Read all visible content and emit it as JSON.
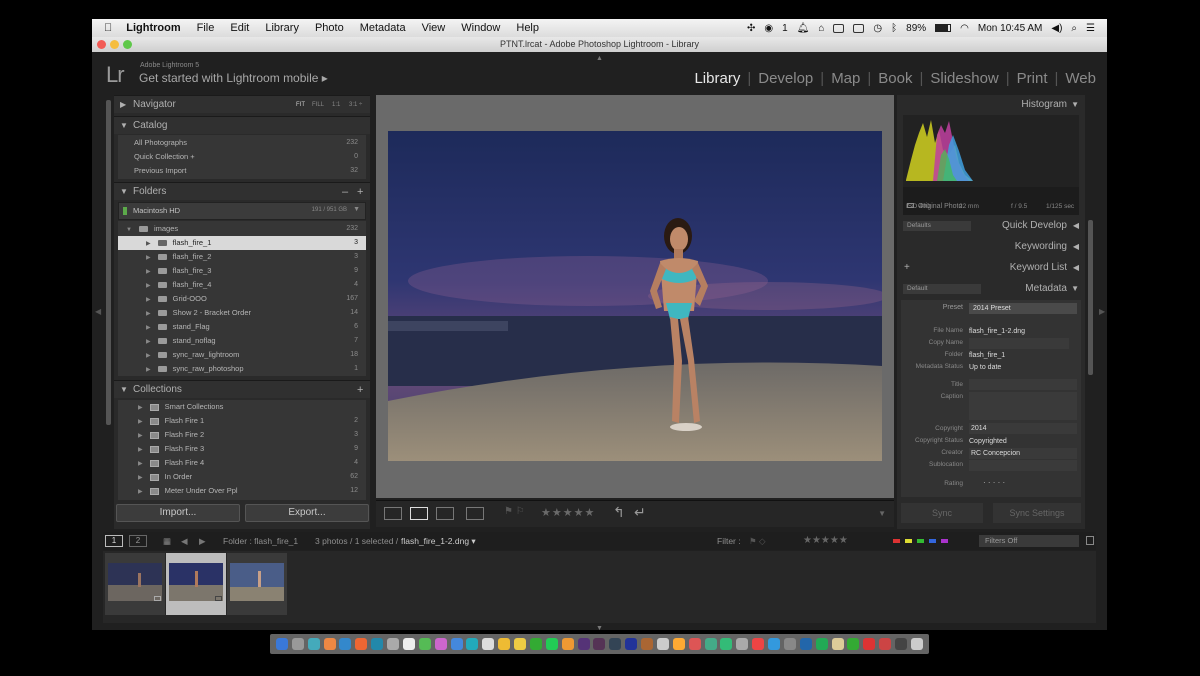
{
  "menubar": {
    "apple": "",
    "app": "Lightroom",
    "items": [
      "File",
      "Edit",
      "Library",
      "Photo",
      "Metadata",
      "View",
      "Window",
      "Help"
    ],
    "badge": "1",
    "battery": "89%",
    "clock": "Mon 10:45 AM"
  },
  "window": {
    "title": "PTNT.lrcat - Adobe Photoshop Lightroom - Library"
  },
  "identity": {
    "logo": "Lr",
    "sub": "Adobe Lightroom 5",
    "mobile": "Get started with Lightroom mobile ▸"
  },
  "modules": [
    "Library",
    "Develop",
    "Map",
    "Book",
    "Slideshow",
    "Print",
    "Web"
  ],
  "navigator": {
    "title": "Navigator",
    "fit": "FIT",
    "fill": "FILL",
    "z1": "1:1",
    "z2": "3:1 ÷"
  },
  "catalog": {
    "title": "Catalog",
    "items": [
      {
        "label": "All Photographs",
        "count": "232"
      },
      {
        "label": "Quick Collection +",
        "count": "0"
      },
      {
        "label": "Previous Import",
        "count": "32"
      }
    ]
  },
  "folders": {
    "title": "Folders",
    "volume": "Macintosh HD",
    "volume_size": "191 / 951 GB",
    "root": {
      "label": "images",
      "count": "232"
    },
    "items": [
      {
        "label": "flash_fire_1",
        "count": "3"
      },
      {
        "label": "flash_fire_2",
        "count": "3"
      },
      {
        "label": "flash_fire_3",
        "count": "9"
      },
      {
        "label": "flash_fire_4",
        "count": "4"
      },
      {
        "label": "Grid-OOO",
        "count": "167"
      },
      {
        "label": "Show 2 - Bracket Order",
        "count": "14"
      },
      {
        "label": "stand_Flag",
        "count": "6"
      },
      {
        "label": "stand_noflag",
        "count": "7"
      },
      {
        "label": "sync_raw_lightroom",
        "count": "18"
      },
      {
        "label": "sync_raw_photoshop",
        "count": "1"
      }
    ]
  },
  "collections": {
    "title": "Collections",
    "items": [
      {
        "label": "Smart Collections",
        "count": ""
      },
      {
        "label": "Flash Fire 1",
        "count": "2"
      },
      {
        "label": "Flash Fire 2",
        "count": "3"
      },
      {
        "label": "Flash Fire 3",
        "count": "9"
      },
      {
        "label": "Flash Fire 4",
        "count": "4"
      },
      {
        "label": "In Order",
        "count": "62"
      },
      {
        "label": "Meter Under Over Ppl",
        "count": "12"
      }
    ]
  },
  "buttons": {
    "import": "Import...",
    "export": "Export...",
    "sync": "Sync",
    "sync_settings": "Sync Settings"
  },
  "histogram": {
    "title": "Histogram",
    "iso": "ISO 400",
    "focal": "22 mm",
    "aperture": "f / 9.5",
    "shutter": "1/125 sec",
    "original": "Original Photo"
  },
  "right_panels": {
    "quick_develop": "Quick Develop",
    "defaults": "Defaults",
    "keywording": "Keywording",
    "keyword_list": "Keyword List",
    "metadata": "Metadata",
    "default": "Default"
  },
  "metadata": {
    "preset_label": "Preset",
    "preset_value": "2014 Preset",
    "fields": [
      {
        "label": "File Name",
        "value": "flash_fire_1-2.dng"
      },
      {
        "label": "Copy Name",
        "value": ""
      },
      {
        "label": "Folder",
        "value": "flash_fire_1"
      },
      {
        "label": "Metadata Status",
        "value": "Up to date"
      },
      {
        "label": "Title",
        "value": ""
      },
      {
        "label": "Caption",
        "value": ""
      },
      {
        "label": "Copyright",
        "value": "2014"
      },
      {
        "label": "Copyright Status",
        "value": "Copyrighted"
      },
      {
        "label": "Creator",
        "value": "RC Concepcion"
      },
      {
        "label": "Sublocation",
        "value": ""
      },
      {
        "label": "Rating",
        "value": "· · · · ·"
      }
    ]
  },
  "filmstrip_bar": {
    "view1": "1",
    "view2": "2",
    "folder": "Folder : flash_fire_1",
    "count": "3 photos / 1 selected /",
    "filename": "flash_fire_1-2.dng ▾",
    "filter_label": "Filter :",
    "filters_off": "Filters Off"
  },
  "toolbar": {
    "stars": "★★★★★"
  }
}
